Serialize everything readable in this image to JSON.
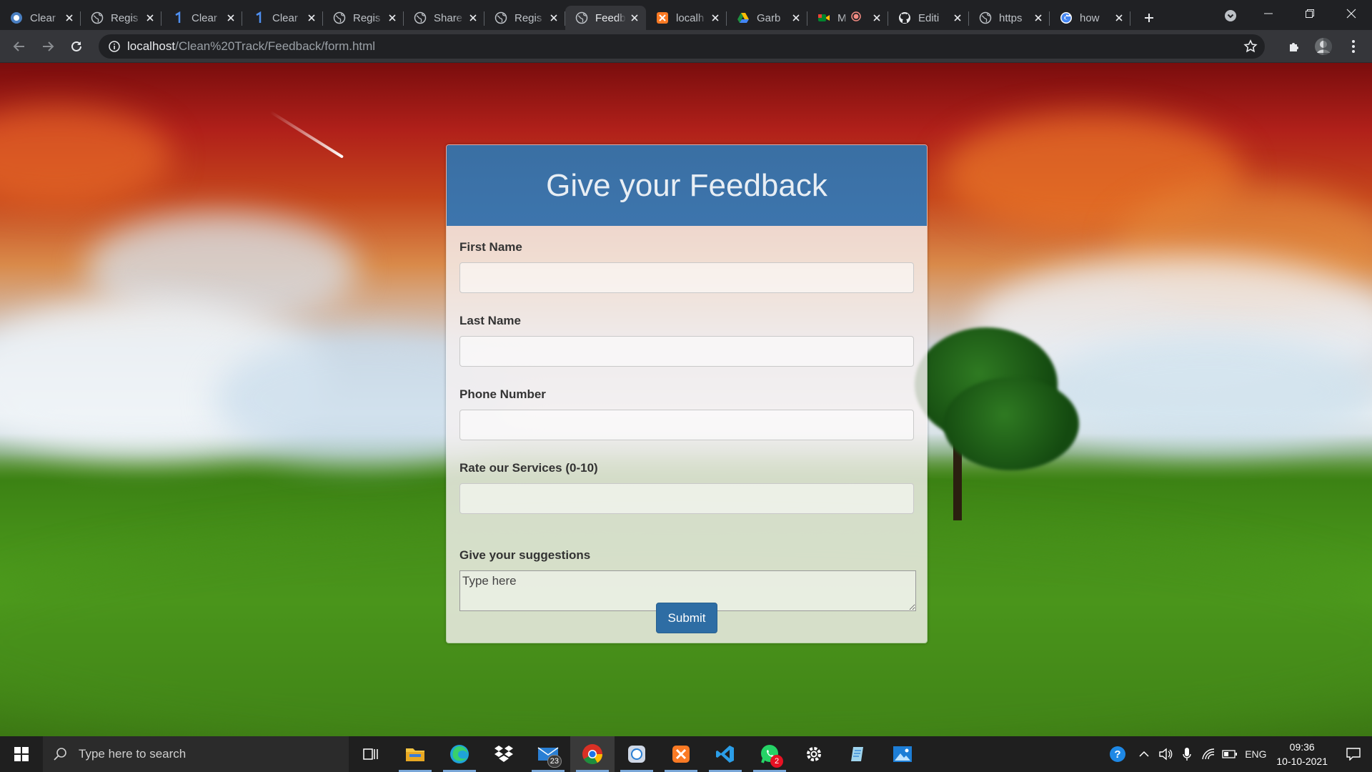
{
  "browser": {
    "tabs": [
      {
        "title": "Clear",
        "favicon": "clean-track-logo-icon",
        "active": false
      },
      {
        "title": "Regis",
        "favicon": "globe-icon",
        "active": false
      },
      {
        "title": "Clear",
        "favicon": "one-logo-icon",
        "active": false
      },
      {
        "title": "Clear",
        "favicon": "one-logo-icon",
        "active": false
      },
      {
        "title": "Regis",
        "favicon": "globe-icon",
        "active": false
      },
      {
        "title": "Share",
        "favicon": "globe-icon",
        "active": false
      },
      {
        "title": "Regis",
        "favicon": "globe-icon",
        "active": false
      },
      {
        "title": "Feedb",
        "favicon": "globe-icon",
        "active": true
      },
      {
        "title": "localh",
        "favicon": "xampp-icon",
        "active": false
      },
      {
        "title": "Garb",
        "favicon": "google-drive-icon",
        "active": false
      },
      {
        "title": "M",
        "favicon": "google-meet-icon",
        "active": false
      },
      {
        "title": "Editi",
        "favicon": "github-icon",
        "active": false
      },
      {
        "title": "https",
        "favicon": "globe-icon",
        "active": false
      },
      {
        "title": "how",
        "favicon": "google-icon",
        "active": false
      }
    ],
    "address": {
      "host": "localhost",
      "path": "/Clean%20Track/Feedback/form.html"
    }
  },
  "form": {
    "title": "Give your Feedback",
    "fields": {
      "first_name": {
        "label": "First Name",
        "value": ""
      },
      "last_name": {
        "label": "Last Name",
        "value": ""
      },
      "phone": {
        "label": "Phone Number",
        "value": ""
      },
      "rating": {
        "label": "Rate our Services (0-10)",
        "value": ""
      },
      "suggestions": {
        "label": "Give your suggestions",
        "placeholder": "Type here"
      }
    },
    "submit_label": "Submit"
  },
  "taskbar": {
    "search_placeholder": "Type here to search",
    "mail_badge": "23",
    "whatsapp_badge": "2",
    "language": "ENG",
    "time": "09:36",
    "date": "10-10-2021"
  },
  "colors": {
    "card_header": "#3a6fa3",
    "submit_button": "#2e6da4",
    "browser_dark": "#202124",
    "browser_toolbar": "#35363a"
  }
}
